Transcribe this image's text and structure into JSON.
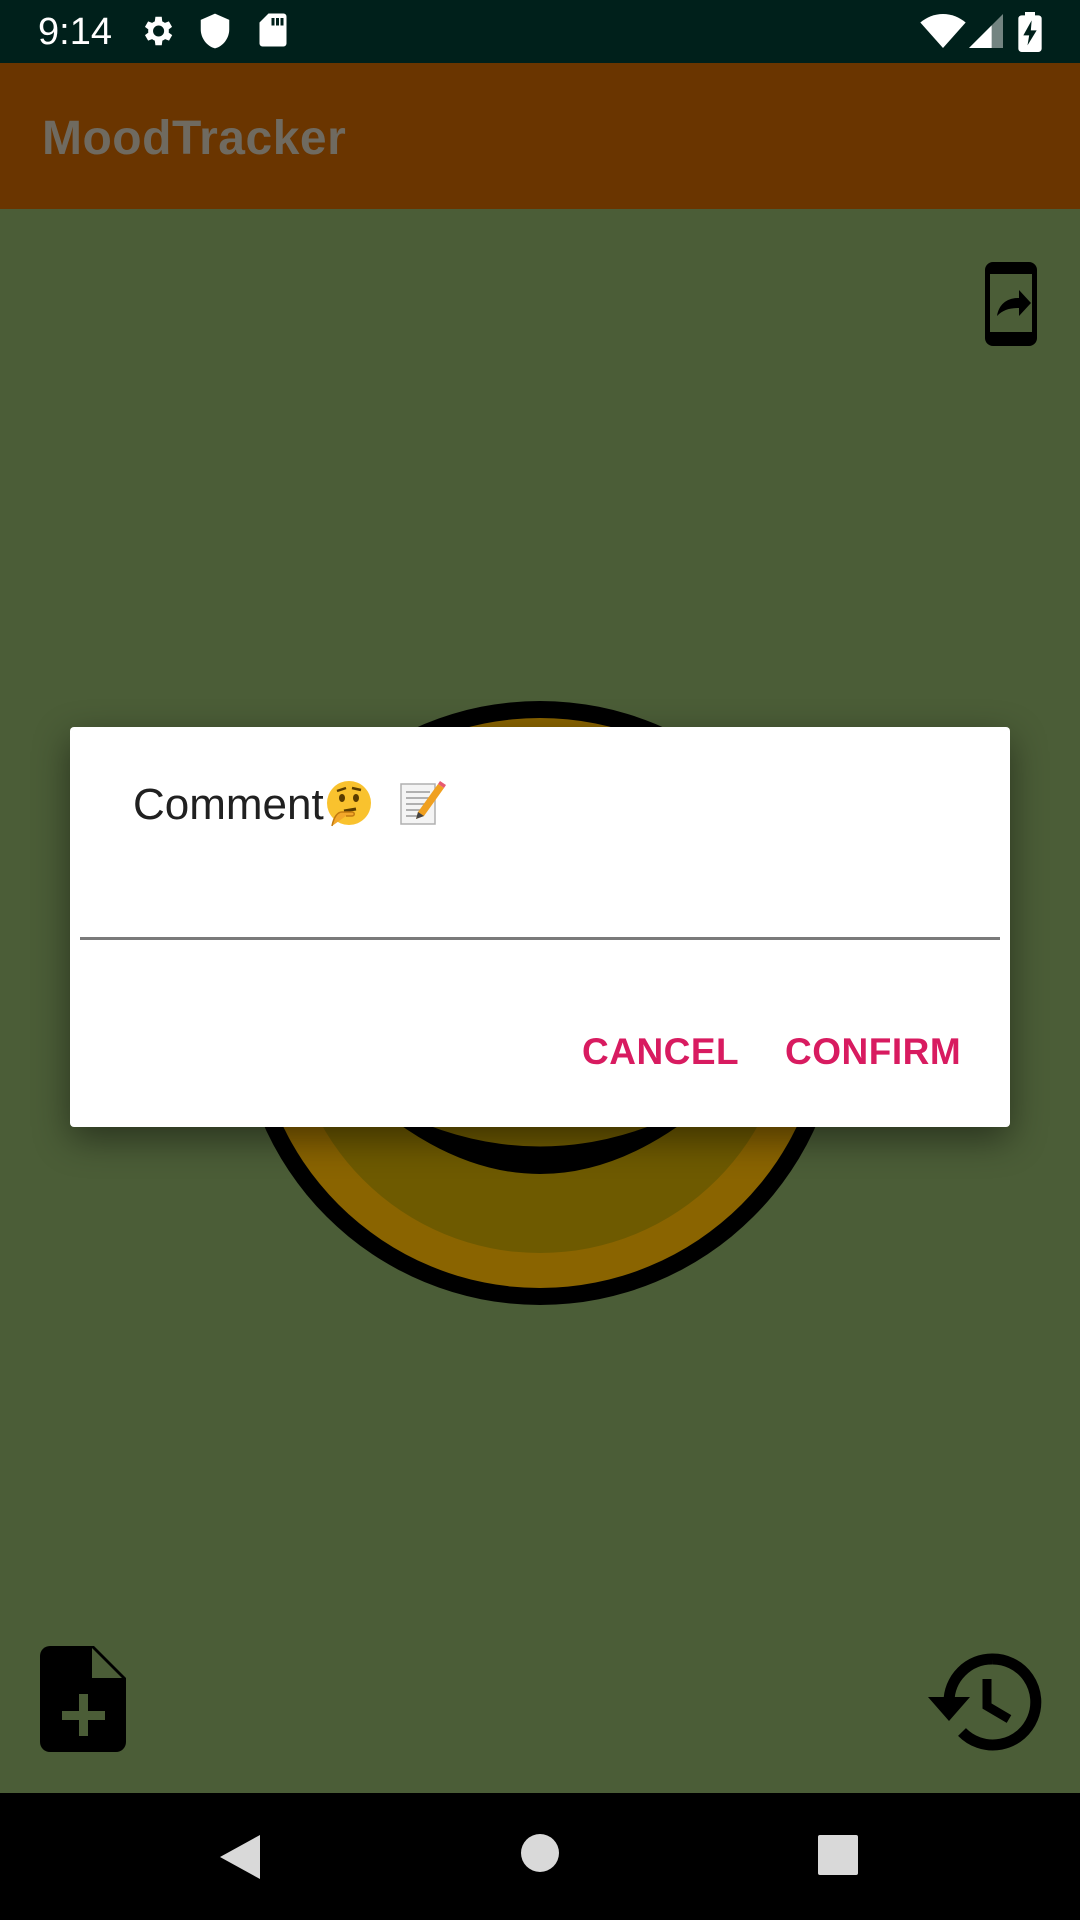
{
  "status_bar": {
    "time": "9:14",
    "icons": [
      "gear-icon",
      "shield-icon",
      "sd-card-icon",
      "wifi-icon",
      "signal-icon",
      "battery-charging-icon"
    ]
  },
  "app_bar": {
    "title": "MoodTracker"
  },
  "main": {
    "share_icon": "phone-forward-icon",
    "mood_icon": "mood-face-icon",
    "add_note_icon": "note-add-icon",
    "history_icon": "history-icon"
  },
  "dialog": {
    "title": "Comment",
    "title_emojis": [
      "thinking-face",
      "memo"
    ],
    "input_value": "",
    "cancel_label": "CANCEL",
    "confirm_label": "CONFIRM"
  },
  "nav_bar": {
    "buttons": [
      "back-icon",
      "home-icon",
      "recents-icon"
    ]
  },
  "colors": {
    "status_bar": "#00201b",
    "app_bar": "#6a3500",
    "background": "#4b5d37",
    "accent": "#d81b60"
  }
}
